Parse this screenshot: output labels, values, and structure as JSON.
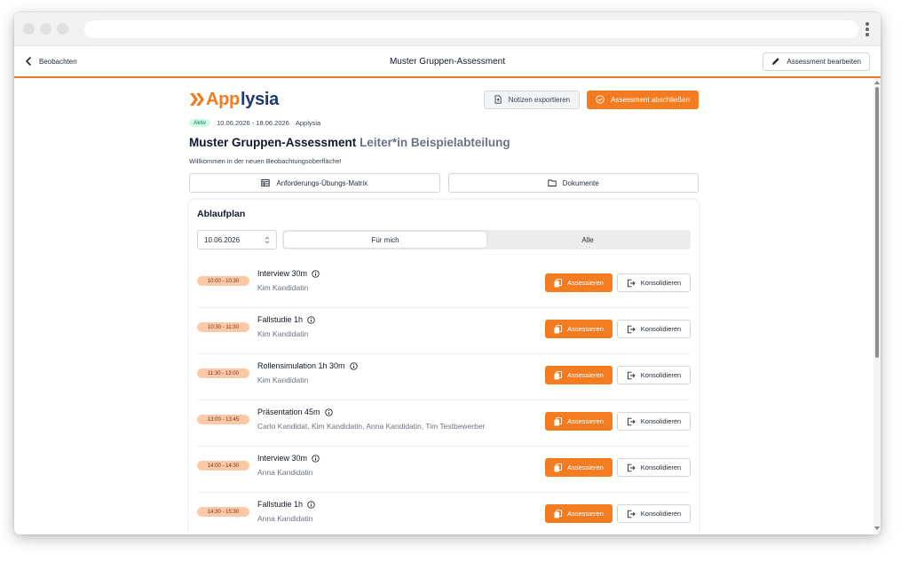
{
  "app": {
    "back_label": "Beobachten",
    "title": "Muster Gruppen-Assessment",
    "edit_label": "Assessment bearbeiten"
  },
  "brand": {
    "logo_part1": "App",
    "logo_part2": "lysia",
    "export_label": "Notizen exportieren",
    "finish_label": "Assessment abschließen"
  },
  "meta": {
    "status": "Aktiv",
    "dates": "10.06.2026 - 18.06.2026",
    "company": "Applysia"
  },
  "heading": {
    "title": "Muster Gruppen-Assessment",
    "subtitle": "Leiter*in Beispielabteilung"
  },
  "welcome": "Willkommen in der neuen Beobachtungsoberfläche!",
  "buttons": {
    "matrix": "Anforderungs-Übungs-Matrix",
    "documents": "Dokumente"
  },
  "schedule": {
    "title": "Ablaufplan",
    "date": "10.06.2026",
    "tab_mine": "Für mich",
    "tab_all": "Alle",
    "assess_label": "Assessieren",
    "consolidate_label": "Konsolidieren",
    "items": [
      {
        "time": "10:00 - 10:30",
        "title": "Interview 30m",
        "people": "Kim Kandidatin"
      },
      {
        "time": "10:30 - 11:30",
        "title": "Fallstudie 1h",
        "people": "Kim Kandidatin"
      },
      {
        "time": "11:30 - 13:00",
        "title": "Rollensimulation 1h 30m",
        "people": "Kim Kandidatin"
      },
      {
        "time": "13:00 - 13:45",
        "title": "Präsentation 45m",
        "people": "Carlo Kandidat, Kim Kandidatin, Anna Kandidatin, Tim Testbewerber"
      },
      {
        "time": "14:00 - 14:30",
        "title": "Interview 30m",
        "people": "Anna Kandidatin"
      },
      {
        "time": "14:30 - 15:30",
        "title": "Fallstudie 1h",
        "people": "Anna Kandidatin"
      }
    ]
  },
  "colors": {
    "accent": "#f47c20",
    "brand_blue": "#1f3a6e",
    "time_pill": "#fbc9a8",
    "status_green_bg": "#d1fae5"
  }
}
